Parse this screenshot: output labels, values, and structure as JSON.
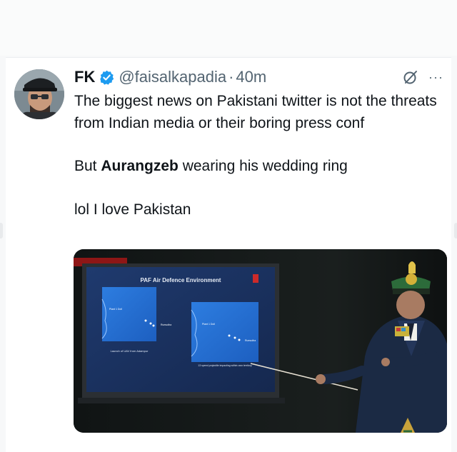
{
  "tweet": {
    "author": {
      "name": "FK",
      "handle": "@faisalkapadia",
      "separator": "·",
      "time": "40m",
      "verified": true,
      "avatar_icon": "user-avatar"
    },
    "text": {
      "paragraph_1": "The biggest news on Pakistani twitter is not the threats from Indian media or their boring press conf",
      "paragraph_2_prefix": "But ",
      "paragraph_2_bold": "Aurangzeb",
      "paragraph_2_suffix": " wearing his wedding ring",
      "paragraph_3": "lol I love Pakistan"
    },
    "actions": {
      "grok_icon": "grok-icon",
      "more_icon": "more-icon",
      "more_glyph": "···"
    },
    "colors": {
      "verified_blue": "#1d9bf0",
      "text_primary": "#0f1419",
      "text_secondary": "#536471"
    },
    "media": {
      "screen_title": "PAF Air Defence Environment",
      "map1_label_1": "Plant 1 Doll",
      "map1_label_2": "Rumudha",
      "map1_caption": "Launch of UAV from Adampur",
      "map2_label_1": "Plant 1 Doll",
      "map2_label_2": "Rumudha",
      "map2_caption": "13 speed projectile impacting within own territory"
    }
  }
}
